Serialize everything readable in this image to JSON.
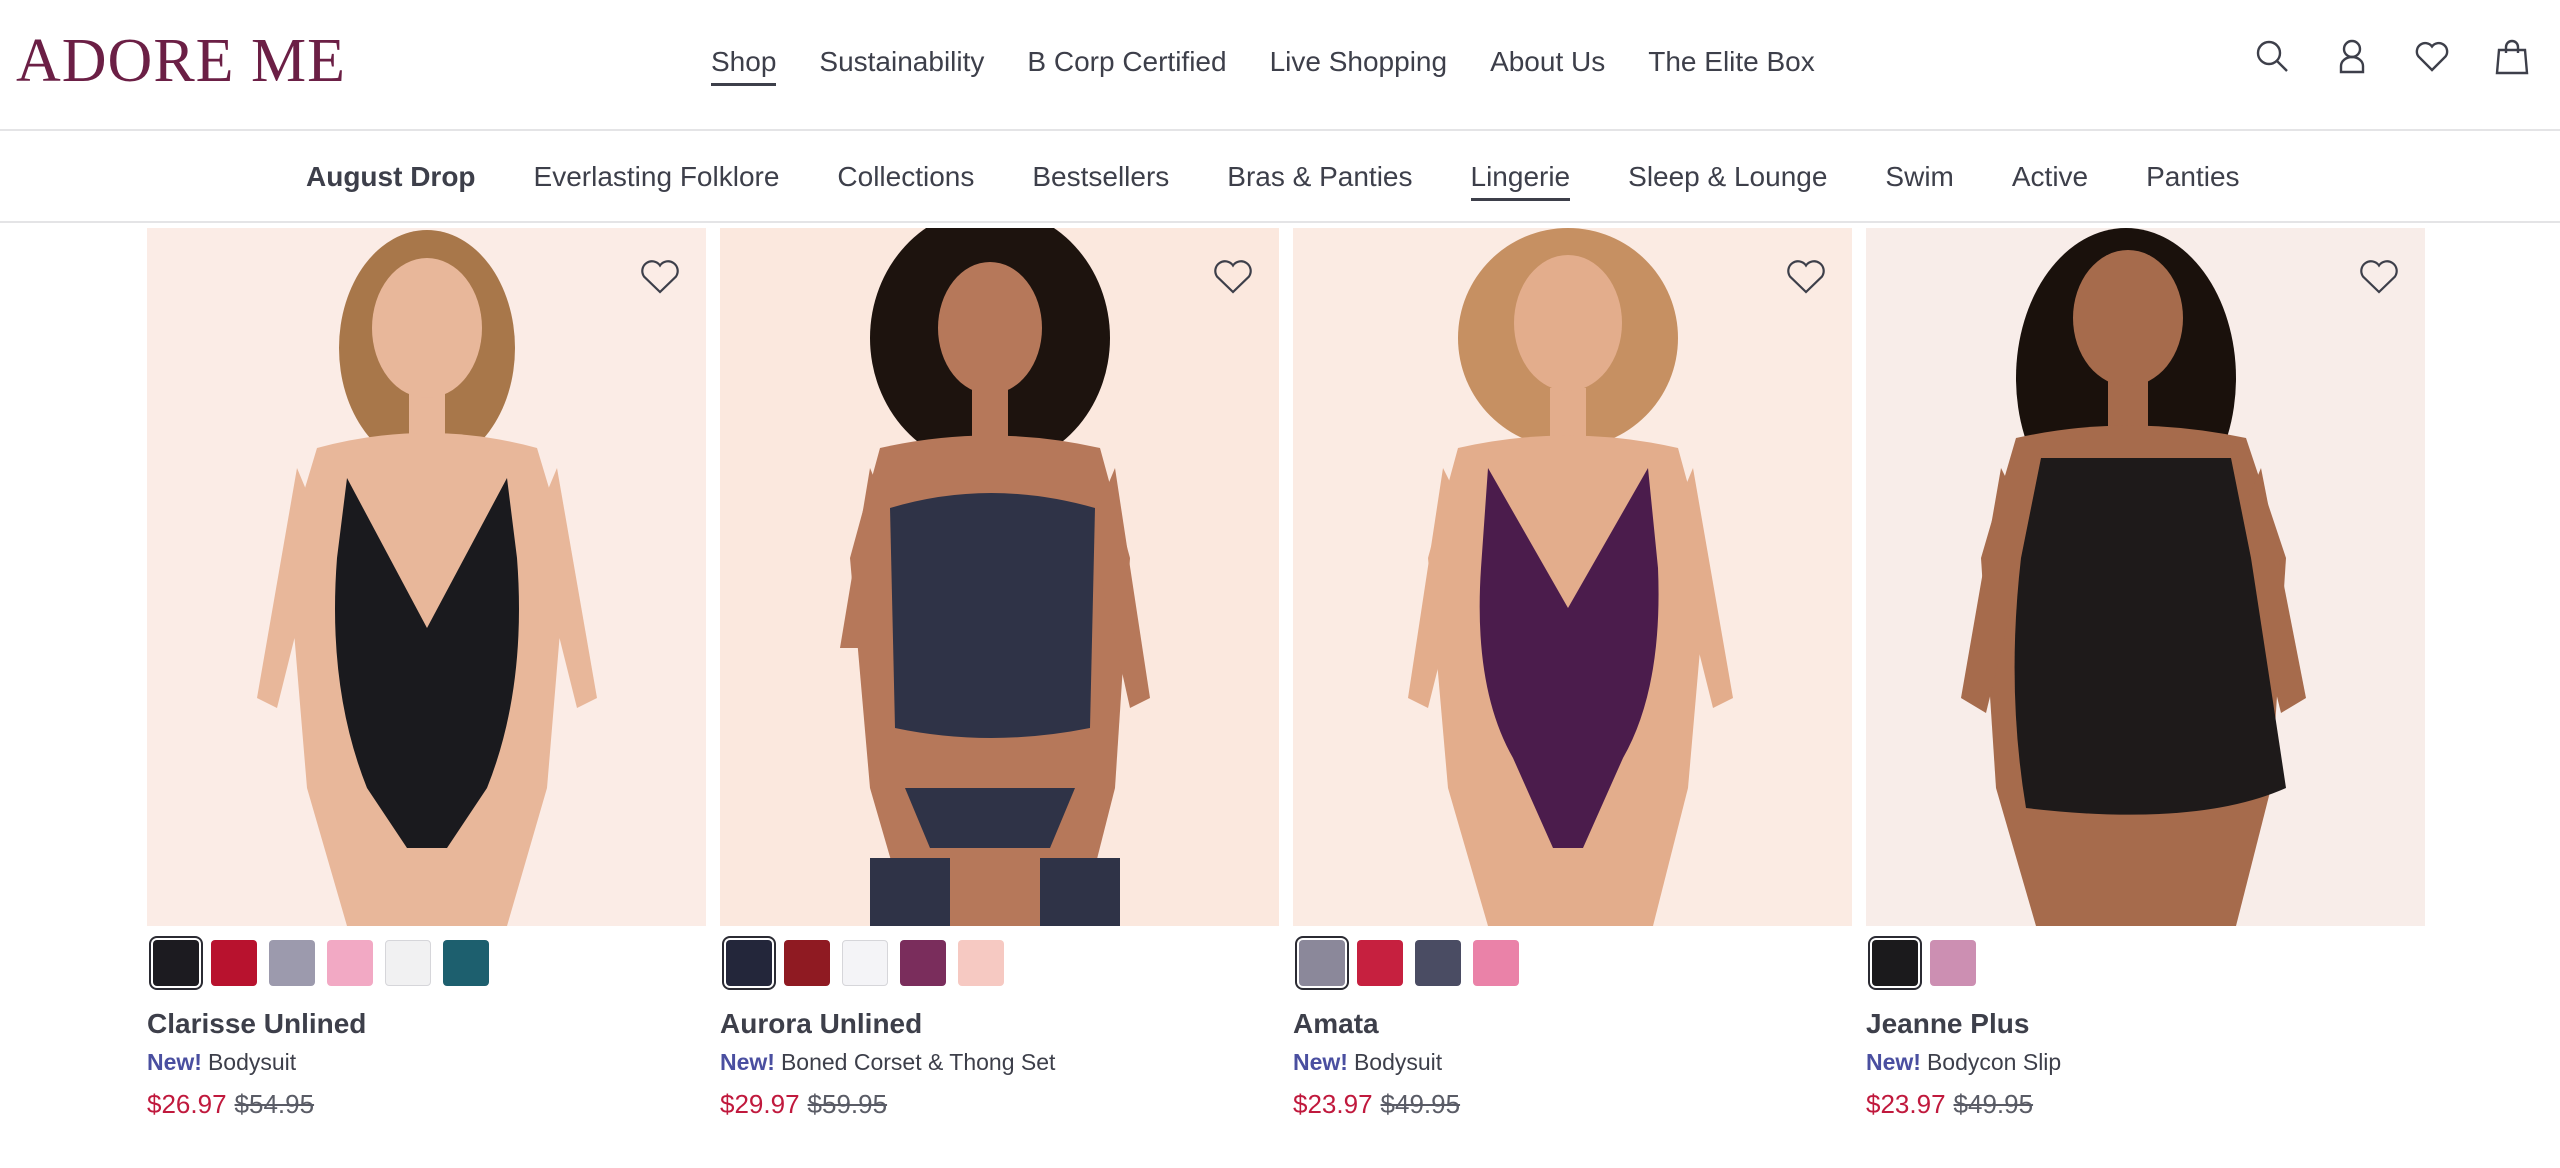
{
  "brand": {
    "logo_text": "ADORE ME",
    "logo_color": "#6b1f45"
  },
  "main_nav": [
    {
      "label": "Shop",
      "active": true
    },
    {
      "label": "Sustainability"
    },
    {
      "label": "B Corp Certified"
    },
    {
      "label": "Live Shopping"
    },
    {
      "label": "About Us"
    },
    {
      "label": "The Elite Box"
    }
  ],
  "header_icons": [
    "search-icon",
    "account-icon",
    "wishlist-heart-icon",
    "shopping-bag-icon"
  ],
  "sub_nav": [
    {
      "label": "August Drop",
      "featured": true
    },
    {
      "label": "Everlasting Folklore"
    },
    {
      "label": "Collections"
    },
    {
      "label": "Bestsellers"
    },
    {
      "label": "Bras & Panties"
    },
    {
      "label": "Lingerie",
      "active": true
    },
    {
      "label": "Sleep & Lounge"
    },
    {
      "label": "Swim"
    },
    {
      "label": "Active"
    },
    {
      "label": "Panties"
    }
  ],
  "colors": {
    "sale_price": "#c0193d",
    "new_badge": "#4a4fa0",
    "text": "#3d3f4a"
  },
  "products": [
    {
      "name": "Clarisse Unlined",
      "badge": "New!",
      "type": "Bodysuit",
      "sale_price": "$26.97",
      "original_price": "$54.95",
      "garment_color": "#1a1a1e",
      "skin": "#e8b79a",
      "hair": "#a8774a",
      "bg": "#fbece6",
      "swatches": [
        "#1c1b20",
        "#b8122e",
        "#9c9aad",
        "#f2a9c4",
        "#f1f1f2",
        "#1d5f6e"
      ],
      "selected_swatch": 0
    },
    {
      "name": "Aurora Unlined",
      "badge": "New!",
      "type": "Boned Corset & Thong Set",
      "sale_price": "$29.97",
      "original_price": "$59.95",
      "garment_color": "#2f3347",
      "skin": "#b6785a",
      "hair": "#1d130e",
      "bg": "#fbe8de",
      "swatches": [
        "#23263a",
        "#8f1a22",
        "#f4f4f7",
        "#7a2d5c",
        "#f6c9c2"
      ],
      "selected_swatch": 0
    },
    {
      "name": "Amata",
      "badge": "New!",
      "type": "Bodysuit",
      "sale_price": "$23.97",
      "original_price": "$49.95",
      "garment_color": "#4b1c4c",
      "skin": "#e3ad8c",
      "hair": "#c69062",
      "bg": "#fbebe3",
      "swatches": [
        "#8b889a",
        "#c6203f",
        "#4a4c63",
        "#ea82a8"
      ],
      "selected_swatch": 0
    },
    {
      "name": "Jeanne Plus",
      "badge": "New!",
      "type": "Bodycon Slip",
      "sale_price": "$23.97",
      "original_price": "$49.95",
      "garment_color": "#1e1a1a",
      "skin": "#a66b4c",
      "hair": "#1a110c",
      "bg": "#f8ede9",
      "swatches": [
        "#1b1a1c",
        "#cc8fb2"
      ],
      "selected_swatch": 0
    }
  ]
}
